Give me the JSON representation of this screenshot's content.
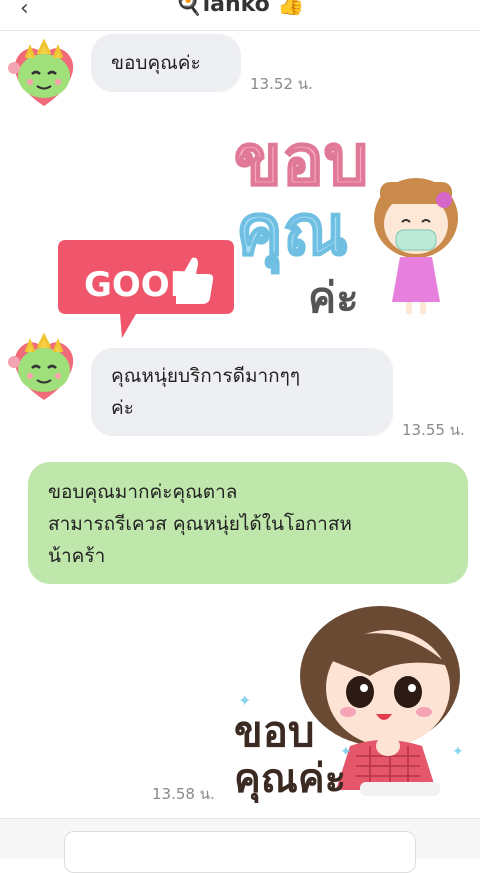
{
  "header": {
    "title": "🍳lanko 👍",
    "back_icon": "‹"
  },
  "messages": [
    {
      "side": "in",
      "text": "ขอบคุณค่ะ",
      "time": "13.52 น."
    },
    {
      "side": "in",
      "sticker": "thank-you-girl-mask-sticker",
      "text": "ขอบคุณค่ะ"
    },
    {
      "side": "in",
      "sticker": "good-thumbs-up-sticker",
      "text": "GOOD"
    },
    {
      "side": "in",
      "text": "คุณหนุ่ยบริการดีมากๆๆ ค่ะ",
      "line1": "คุณหนุ่ยบริการดีมากๆๆ",
      "line2": "ค่ะ",
      "time": "13.55 น."
    },
    {
      "side": "out",
      "line1": "ขอบคุณมากค่ะคุณตาล",
      "line2": "สามารถรีเควส คุณหนุ่ยได้ในโอกาสห",
      "line3": "น้าคร้า"
    },
    {
      "side": "out",
      "sticker": "thank-you-girl-sticker",
      "text_1": "ขอบ",
      "text_2": "คุณค่ะ",
      "time": "13.58 น."
    }
  ],
  "colors": {
    "incoming_bubble": "#eeeff2",
    "outgoing_bubble": "#bfe6ab",
    "good_sticker": "#f0566b"
  },
  "avatar_icon": "green-dragon-avatar"
}
